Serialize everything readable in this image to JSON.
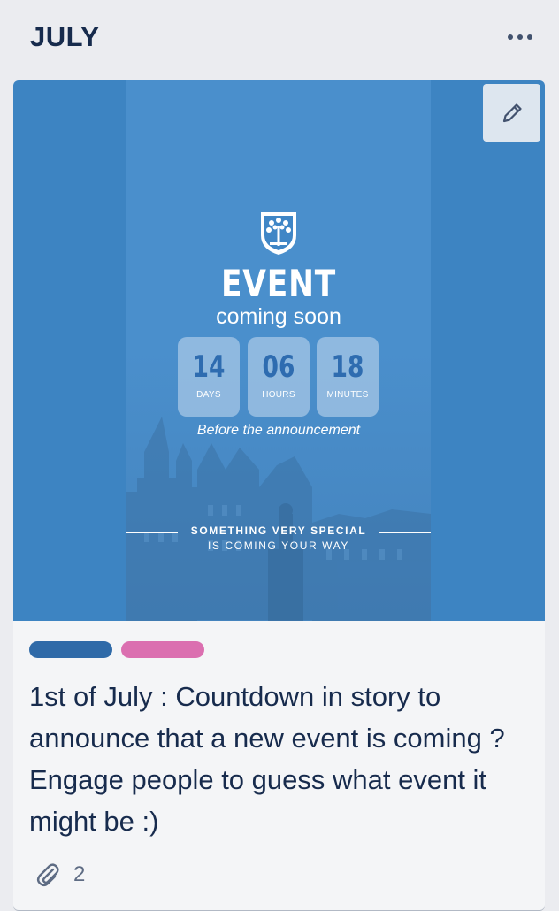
{
  "list": {
    "title": "JULY",
    "menu_icon": "more-horizontal-icon"
  },
  "card": {
    "cover": {
      "event_title": "EVENT",
      "event_subtitle": "coming soon",
      "countdown": [
        {
          "value": "14",
          "unit": "DAYS"
        },
        {
          "value": "06",
          "unit": "HOURS"
        },
        {
          "value": "18",
          "unit": "MINUTES"
        }
      ],
      "before_text": "Before the announcement",
      "special_text": "SOMETHING VERY SPECIAL",
      "coming_text": "IS COMING YOUR WAY",
      "background_color": "#3d84c2"
    },
    "edit_icon": "pencil-icon",
    "labels": [
      {
        "color": "#2f6aa8"
      },
      {
        "color": "#db6fb0"
      }
    ],
    "title": "1st of July : Countdown in story to announce that a new event is coming ? Engage people to guess what event it might be :)",
    "attachments": {
      "icon": "paperclip-icon",
      "count": "2"
    }
  }
}
